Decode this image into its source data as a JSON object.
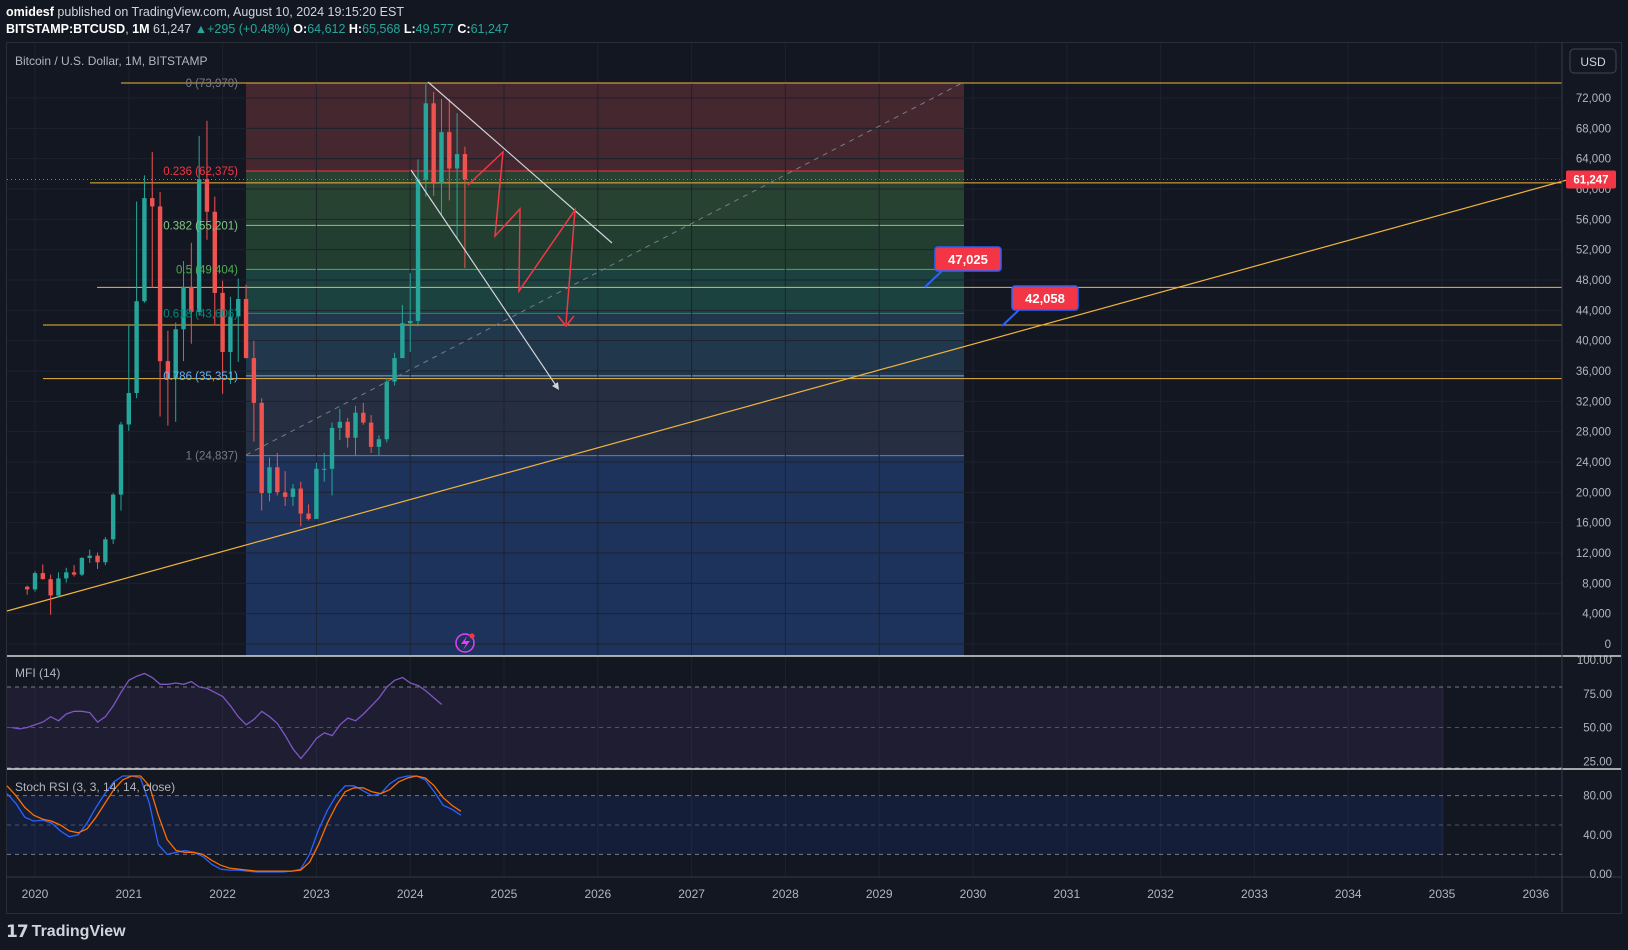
{
  "header": {
    "author": "omidesf",
    "published_text": "published on TradingView.com, August 10, 2024 19:15:20 EST",
    "symbol": "BITSTAMP:BTCUSD",
    "interval": "1M",
    "last": "61,247",
    "change": "+295 (+0.48%)",
    "open_label": "O:",
    "open": "64,612",
    "high_label": "H:",
    "high": "65,568",
    "low_label": "L:",
    "low": "49,577",
    "close_label": "C:",
    "close": "61,247"
  },
  "chart_title": "Bitcoin / U.S. Dollar, 1M, BITSTAMP",
  "currency_button": "USD",
  "footer": {
    "logo_text": "TradingView",
    "logo_mark": "17"
  },
  "colors": {
    "up": "#26a69a",
    "down": "#ef5350",
    "level": "#f0b43c",
    "accent": "#2962ff",
    "mfi": "#7e57c2",
    "stoch_k": "#2962ff",
    "stoch_d": "#ff6d00"
  },
  "chart_data": [
    {
      "type": "candlestick",
      "title": "Bitcoin / U.S. Dollar, 1M, BITSTAMP",
      "x_ticks": [
        "2020",
        "2021",
        "2022",
        "2023",
        "2024",
        "2025",
        "2026",
        "2027",
        "2028",
        "2029",
        "2030",
        "2031",
        "2032",
        "2033",
        "2034",
        "2035",
        "2036"
      ],
      "y_ticks": [
        "72,000",
        "68,000",
        "64,000",
        "60,000",
        "56,000",
        "52,000",
        "48,000",
        "44,000",
        "40,000",
        "36,000",
        "32,000",
        "28,000",
        "24,000",
        "20,000",
        "16,000",
        "12,000",
        "8,000",
        "4,000",
        "0"
      ],
      "ylim": [
        0,
        76000
      ],
      "last_price_label": "61,247",
      "last_price": 61247,
      "candles": [
        {
          "t": "2019-12",
          "o": 7550,
          "h": 7700,
          "l": 6500,
          "c": 7200
        },
        {
          "t": "2020-01",
          "o": 7200,
          "h": 9600,
          "l": 6900,
          "c": 9350
        },
        {
          "t": "2020-02",
          "o": 9350,
          "h": 10500,
          "l": 8500,
          "c": 8550
        },
        {
          "t": "2020-03",
          "o": 8550,
          "h": 9150,
          "l": 3850,
          "c": 6400
        },
        {
          "t": "2020-04",
          "o": 6400,
          "h": 9450,
          "l": 6150,
          "c": 8650
        },
        {
          "t": "2020-05",
          "o": 8650,
          "h": 10050,
          "l": 8100,
          "c": 9450
        },
        {
          "t": "2020-06",
          "o": 9450,
          "h": 10400,
          "l": 8900,
          "c": 9150
        },
        {
          "t": "2020-07",
          "o": 9150,
          "h": 11450,
          "l": 8950,
          "c": 11350
        },
        {
          "t": "2020-08",
          "o": 11350,
          "h": 12450,
          "l": 10700,
          "c": 11650
        },
        {
          "t": "2020-09",
          "o": 11650,
          "h": 12050,
          "l": 9900,
          "c": 10780
        },
        {
          "t": "2020-10",
          "o": 10780,
          "h": 14100,
          "l": 10400,
          "c": 13800
        },
        {
          "t": "2020-11",
          "o": 13800,
          "h": 19900,
          "l": 13200,
          "c": 19700
        },
        {
          "t": "2020-12",
          "o": 19700,
          "h": 29300,
          "l": 17600,
          "c": 28950
        },
        {
          "t": "2021-01",
          "o": 28950,
          "h": 41950,
          "l": 28100,
          "c": 33100
        },
        {
          "t": "2021-02",
          "o": 33100,
          "h": 58350,
          "l": 32400,
          "c": 45200
        },
        {
          "t": "2021-03",
          "o": 45200,
          "h": 61800,
          "l": 45000,
          "c": 58800
        },
        {
          "t": "2021-04",
          "o": 58800,
          "h": 64900,
          "l": 47000,
          "c": 57700
        },
        {
          "t": "2021-05",
          "o": 57700,
          "h": 59600,
          "l": 30000,
          "c": 37300
        },
        {
          "t": "2021-06",
          "o": 37300,
          "h": 41300,
          "l": 28800,
          "c": 35000
        },
        {
          "t": "2021-07",
          "o": 35000,
          "h": 42400,
          "l": 29300,
          "c": 41500
        },
        {
          "t": "2021-08",
          "o": 41500,
          "h": 50500,
          "l": 37300,
          "c": 47100
        },
        {
          "t": "2021-09",
          "o": 47100,
          "h": 52900,
          "l": 39600,
          "c": 43800
        },
        {
          "t": "2021-10",
          "o": 43800,
          "h": 67000,
          "l": 43300,
          "c": 61300
        },
        {
          "t": "2021-11",
          "o": 61300,
          "h": 69000,
          "l": 53300,
          "c": 57000
        },
        {
          "t": "2021-12",
          "o": 57000,
          "h": 59000,
          "l": 42000,
          "c": 46300
        },
        {
          "t": "2022-01",
          "o": 46300,
          "h": 47900,
          "l": 33000,
          "c": 38500
        },
        {
          "t": "2022-02",
          "o": 38500,
          "h": 45800,
          "l": 34300,
          "c": 43200
        },
        {
          "t": "2022-03",
          "o": 43200,
          "h": 48200,
          "l": 37200,
          "c": 45500
        },
        {
          "t": "2022-04",
          "o": 45500,
          "h": 47400,
          "l": 37700,
          "c": 37700
        },
        {
          "t": "2022-05",
          "o": 37700,
          "h": 40000,
          "l": 26700,
          "c": 31800
        },
        {
          "t": "2022-06",
          "o": 31800,
          "h": 32400,
          "l": 17600,
          "c": 19900
        },
        {
          "t": "2022-07",
          "o": 19900,
          "h": 24600,
          "l": 18800,
          "c": 23300
        },
        {
          "t": "2022-08",
          "o": 23300,
          "h": 25200,
          "l": 19600,
          "c": 20000
        },
        {
          "t": "2022-09",
          "o": 20000,
          "h": 22800,
          "l": 18200,
          "c": 19400
        },
        {
          "t": "2022-10",
          "o": 19400,
          "h": 21100,
          "l": 18200,
          "c": 20500
        },
        {
          "t": "2022-11",
          "o": 20500,
          "h": 21400,
          "l": 15500,
          "c": 17200
        },
        {
          "t": "2022-12",
          "o": 17200,
          "h": 18400,
          "l": 16300,
          "c": 16500
        },
        {
          "t": "2023-01",
          "o": 16500,
          "h": 23900,
          "l": 16500,
          "c": 23100
        },
        {
          "t": "2023-02",
          "o": 23100,
          "h": 25200,
          "l": 21400,
          "c": 23100
        },
        {
          "t": "2023-03",
          "o": 23100,
          "h": 29200,
          "l": 19600,
          "c": 28500
        },
        {
          "t": "2023-04",
          "o": 28500,
          "h": 31000,
          "l": 26900,
          "c": 29300
        },
        {
          "t": "2023-05",
          "o": 29300,
          "h": 29800,
          "l": 25900,
          "c": 27200
        },
        {
          "t": "2023-06",
          "o": 27200,
          "h": 31400,
          "l": 24800,
          "c": 30500
        },
        {
          "t": "2023-07",
          "o": 30500,
          "h": 31800,
          "l": 28900,
          "c": 29200
        },
        {
          "t": "2023-08",
          "o": 29200,
          "h": 30200,
          "l": 25200,
          "c": 26000
        },
        {
          "t": "2023-09",
          "o": 26000,
          "h": 27500,
          "l": 24900,
          "c": 27000
        },
        {
          "t": "2023-10",
          "o": 27000,
          "h": 35000,
          "l": 26600,
          "c": 34600
        },
        {
          "t": "2023-11",
          "o": 34600,
          "h": 38400,
          "l": 34100,
          "c": 37700
        },
        {
          "t": "2023-12",
          "o": 37700,
          "h": 44700,
          "l": 37700,
          "c": 42300
        },
        {
          "t": "2024-01",
          "o": 42300,
          "h": 48900,
          "l": 38500,
          "c": 42600
        },
        {
          "t": "2024-02",
          "o": 42600,
          "h": 63900,
          "l": 41900,
          "c": 61200
        },
        {
          "t": "2024-03",
          "o": 61200,
          "h": 73800,
          "l": 59000,
          "c": 71300
        },
        {
          "t": "2024-04",
          "o": 71300,
          "h": 72800,
          "l": 59100,
          "c": 60700
        },
        {
          "t": "2024-05",
          "o": 60700,
          "h": 71900,
          "l": 56500,
          "c": 67500
        },
        {
          "t": "2024-06",
          "o": 67500,
          "h": 71900,
          "l": 58500,
          "c": 62700
        },
        {
          "t": "2024-07",
          "o": 62700,
          "h": 70000,
          "l": 53500,
          "c": 64600
        },
        {
          "t": "2024-08",
          "o": 64612,
          "h": 65568,
          "l": 49577,
          "c": 61247
        }
      ],
      "fib_levels": [
        {
          "label": "0 (73,970)",
          "ratio": 0,
          "price": 73970
        },
        {
          "label": "0.236 (62,375)",
          "ratio": 0.236,
          "price": 62375
        },
        {
          "label": "0.382 (55,201)",
          "ratio": 0.382,
          "price": 55201
        },
        {
          "label": "0.5 (49,404)",
          "ratio": 0.5,
          "price": 49404
        },
        {
          "label": "0.618 (43,606)",
          "ratio": 0.618,
          "price": 43606
        },
        {
          "label": "0.786 (35,351)",
          "ratio": 0.786,
          "price": 35351
        },
        {
          "label": "1 (24,837)",
          "ratio": 1,
          "price": 24837
        }
      ],
      "horizontal_levels": [
        73970,
        60800,
        47025,
        42058,
        35000
      ],
      "callouts": [
        {
          "label": "47,025",
          "price": 47025
        },
        {
          "label": "42,058",
          "price": 42058
        }
      ]
    },
    {
      "type": "line",
      "title": "MFI (14)",
      "y_ticks": [
        "100.00",
        "75.00",
        "50.00",
        "25.00"
      ],
      "ylim": [
        20,
        100
      ],
      "bands": [
        80,
        20
      ],
      "series": [
        {
          "values": [
            50,
            49,
            50,
            52,
            54,
            58,
            55,
            60,
            62,
            62,
            61,
            54,
            58,
            66,
            76,
            85,
            88,
            90,
            87,
            82,
            82,
            83,
            82,
            84,
            80,
            79,
            76,
            73,
            66,
            58,
            52,
            56,
            62,
            58,
            53,
            44,
            34,
            27,
            34,
            42,
            46,
            44,
            52,
            57,
            55,
            60,
            66,
            72,
            80,
            85,
            87,
            83,
            81,
            77,
            72,
            67
          ]
        }
      ]
    },
    {
      "type": "line",
      "title": "Stoch RSI (3, 3, 14, 14, close)",
      "y_ticks": [
        "80.00",
        "40.00",
        "0.00"
      ],
      "ylim": [
        0,
        100
      ],
      "bands": [
        80,
        20
      ],
      "series": [
        {
          "values": [
            82,
            72,
            58,
            54,
            55,
            52,
            44,
            38,
            40,
            52,
            68,
            82,
            94,
            100,
            100,
            98,
            72,
            30,
            20,
            22,
            24,
            22,
            18,
            10,
            5,
            4,
            4,
            3,
            2,
            2,
            2,
            2,
            3,
            5,
            20,
            45,
            65,
            80,
            90,
            90,
            85,
            80,
            82,
            92,
            98,
            100,
            100,
            96,
            84,
            70,
            66,
            60
          ]
        },
        {
          "values": [
            90,
            80,
            68,
            60,
            56,
            54,
            50,
            44,
            42,
            46,
            58,
            72,
            86,
            96,
            100,
            100,
            90,
            60,
            35,
            24,
            22,
            22,
            20,
            14,
            9,
            6,
            5,
            4,
            3,
            3,
            3,
            3,
            3,
            4,
            12,
            30,
            52,
            70,
            84,
            88,
            88,
            84,
            82,
            86,
            94,
            98,
            100,
            98,
            90,
            78,
            70,
            64
          ]
        }
      ]
    }
  ]
}
